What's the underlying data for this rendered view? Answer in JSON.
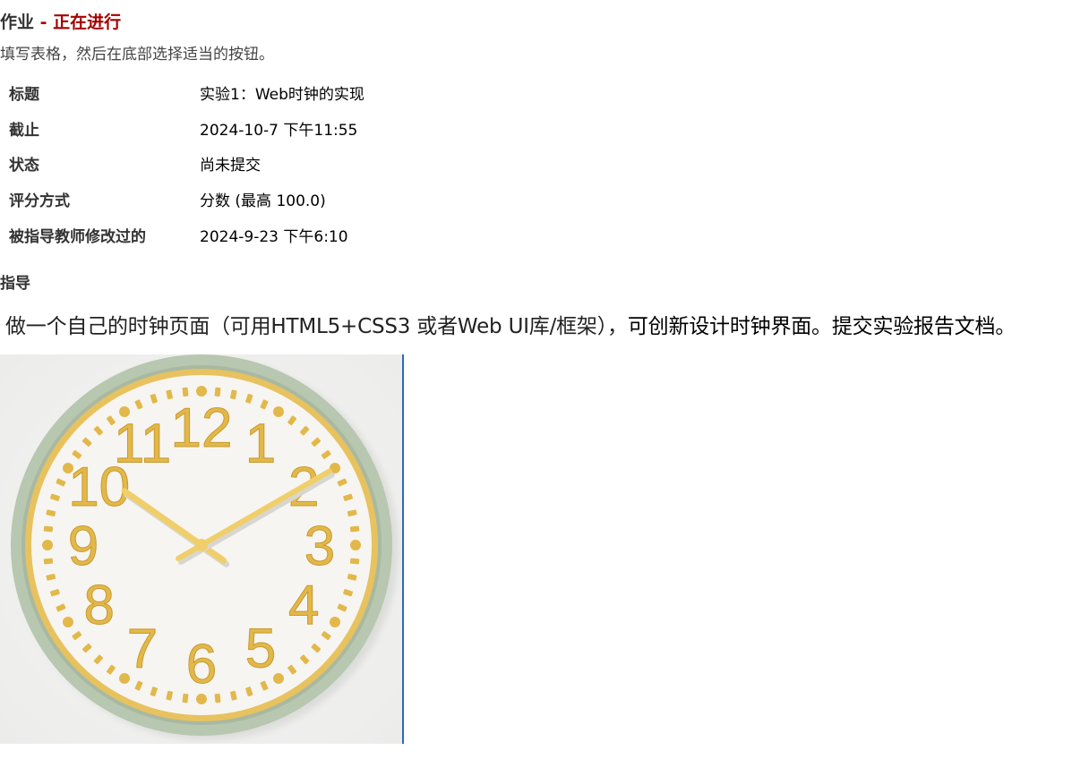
{
  "header": {
    "title": "作业",
    "separator": "-",
    "status": "正在进行"
  },
  "instructions": "填写表格，然后在底部选择适当的按钮。",
  "details": [
    {
      "label": "标题",
      "value": "实验1：Web时钟的实现"
    },
    {
      "label": "截止",
      "value": "2024-10-7 下午11:55"
    },
    {
      "label": "状态",
      "value": "尚未提交"
    },
    {
      "label": "评分方式",
      "value": "分数 (最高 100.0)"
    },
    {
      "label": "被指导教师修改过的",
      "value": "2024-9-23 下午6:10"
    }
  ],
  "guide": {
    "heading": "指导",
    "text_part1": "做一个自己的时钟页面（可用HTML5+CSS3 或者Web UI库/框架），",
    "text_part2": "可创新设计时钟界面。提交实验报告文档。"
  },
  "clock_image": {
    "numerals": [
      "12",
      "1",
      "2",
      "3",
      "4",
      "5",
      "6",
      "7",
      "8",
      "9",
      "10",
      "11"
    ],
    "time_shown": "10:10",
    "colors": {
      "rim": "#b8c7b0",
      "inner_ring": "#e7c25f",
      "face": "#f7f5f1",
      "numerals": "#e2b84a",
      "hands": "#f0cf6a",
      "background": "#f4f4f3"
    }
  }
}
